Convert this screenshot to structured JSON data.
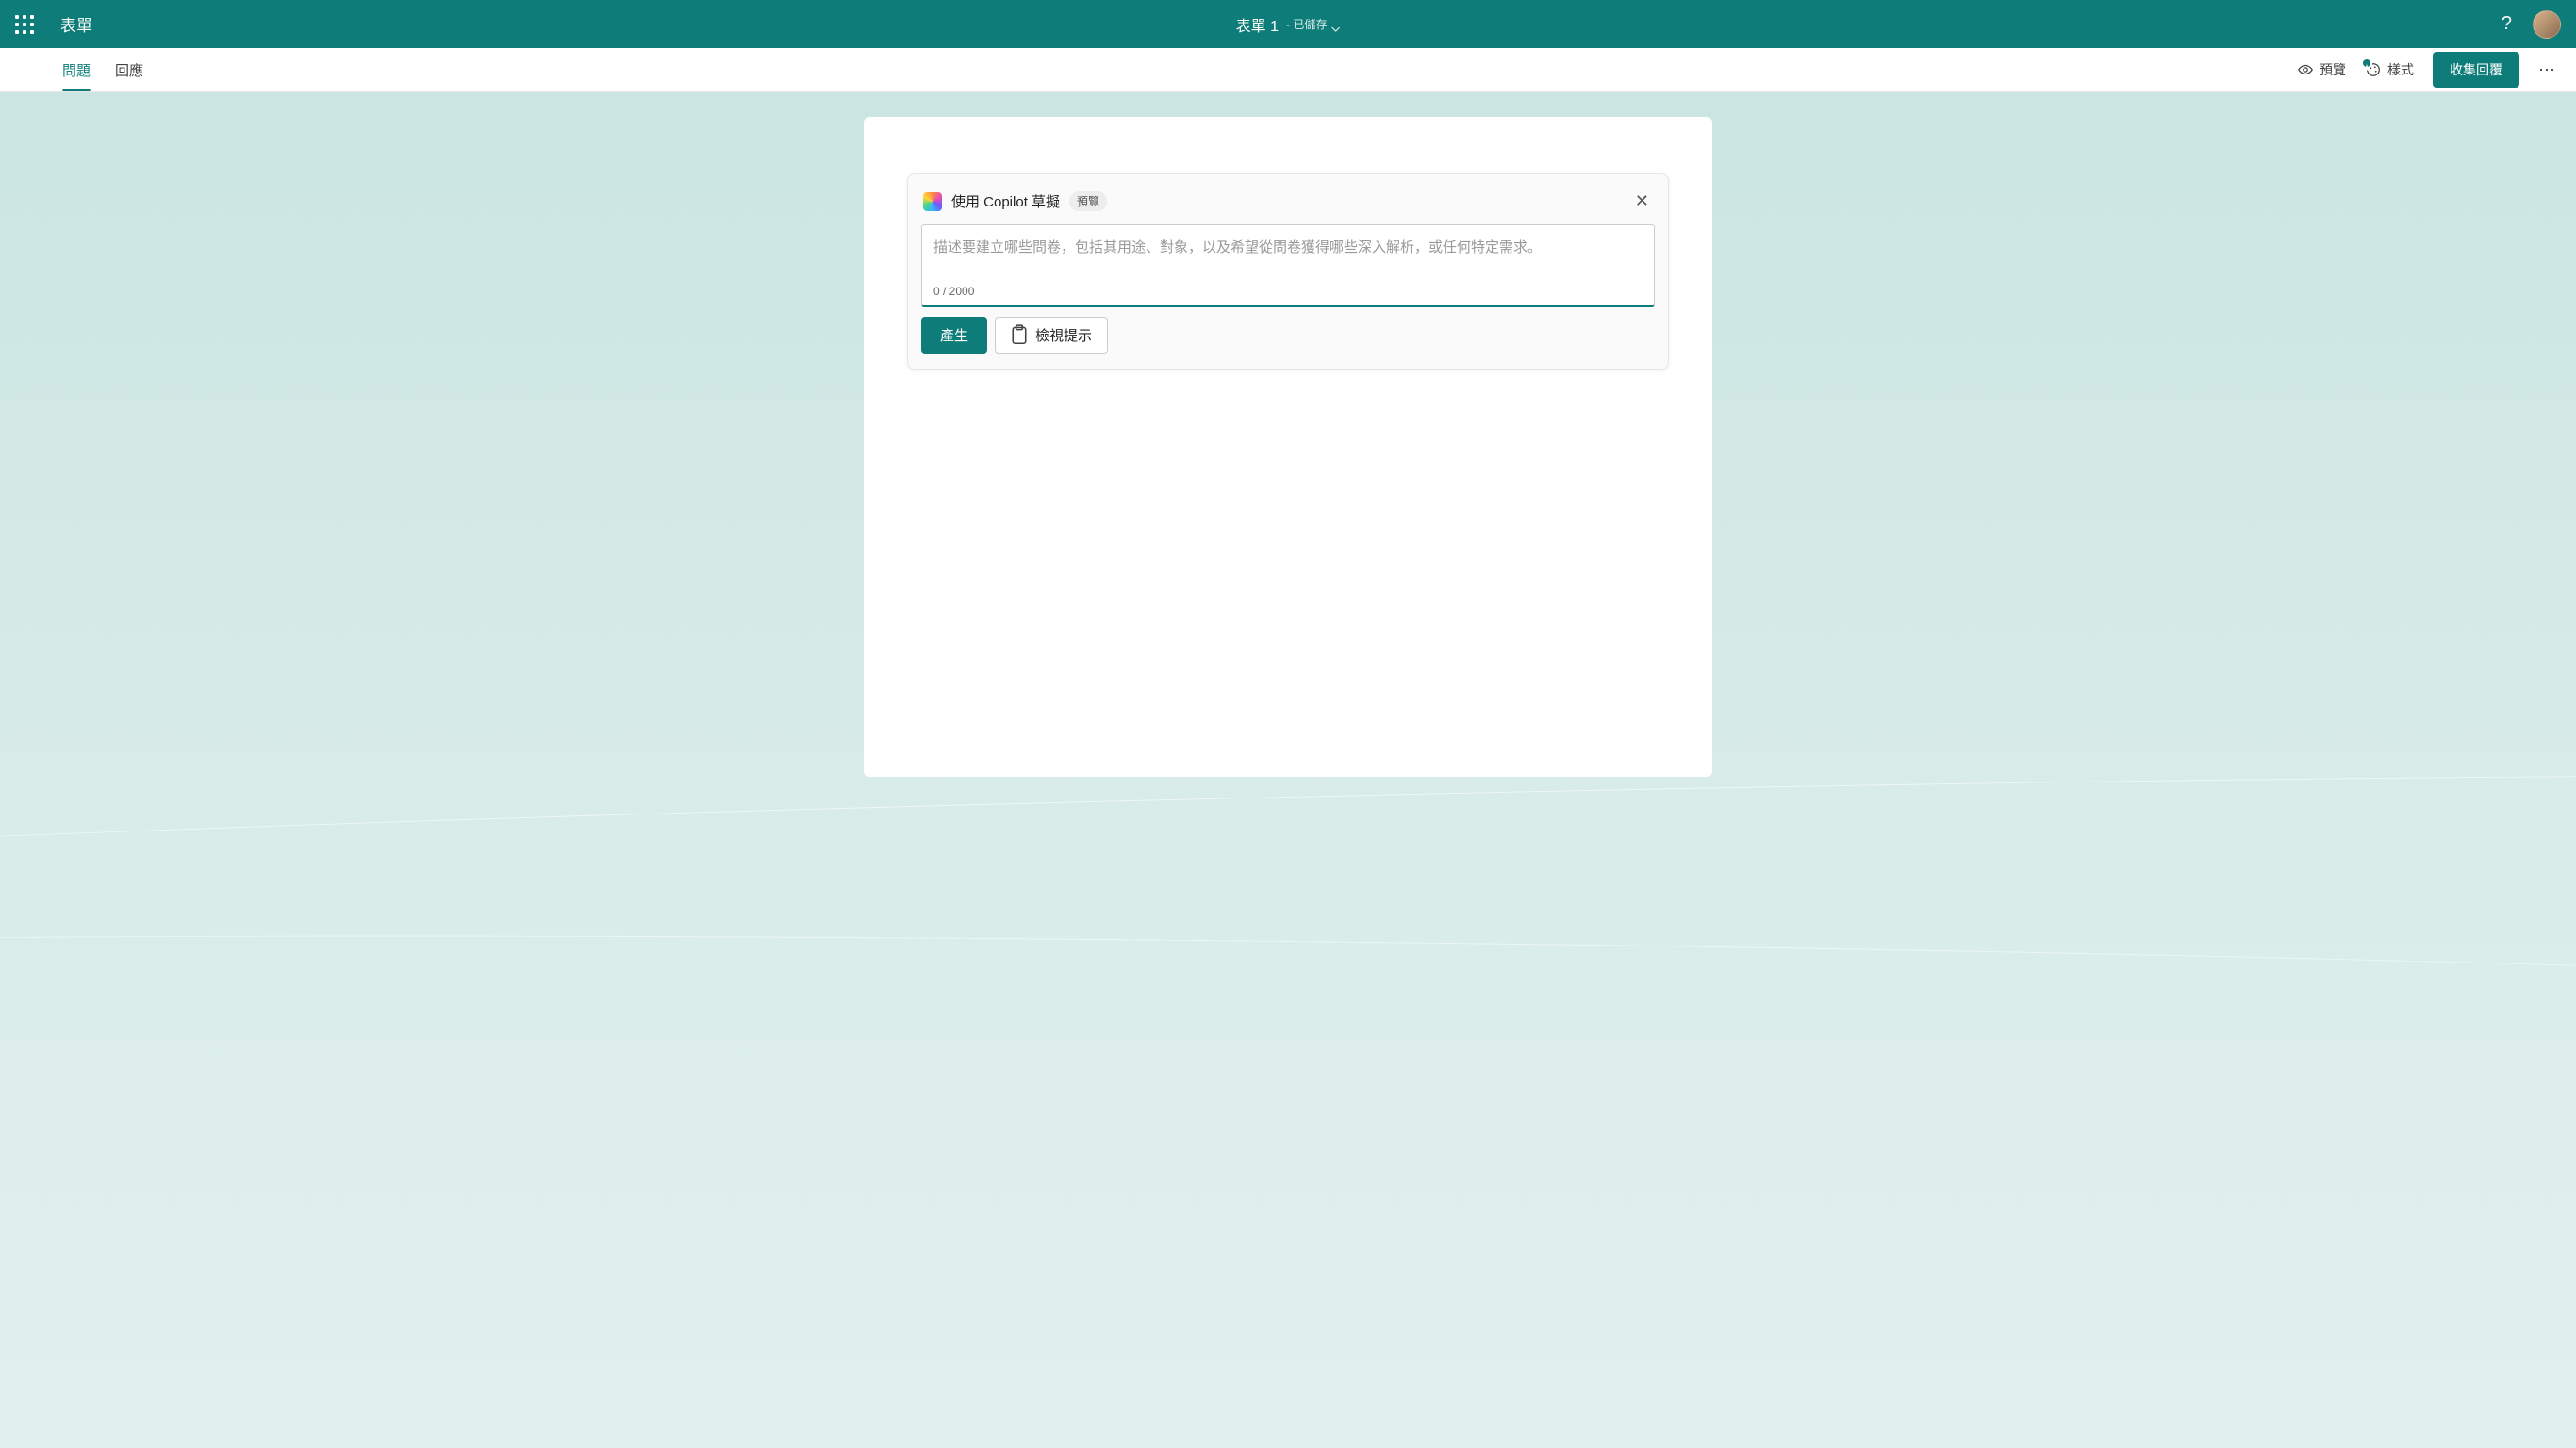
{
  "header": {
    "app_name": "表單",
    "doc_title": "表單 1",
    "saved_label": "- 已儲存"
  },
  "cmdbar": {
    "tabs": [
      {
        "label": "問題",
        "active": true
      },
      {
        "label": "回應",
        "active": false
      }
    ],
    "preview_label": "預覽",
    "style_label": "樣式",
    "collect_label": "收集回覆"
  },
  "copilot": {
    "title": "使用 Copilot 草擬",
    "badge": "預覽",
    "placeholder": "描述要建立哪些問卷，包括其用途、對象，以及希望從問卷獲得哪些深入解析，或任何特定需求。",
    "char_count": "0 / 2000",
    "generate_label": "產生",
    "view_prompt_label": "檢視提示"
  }
}
